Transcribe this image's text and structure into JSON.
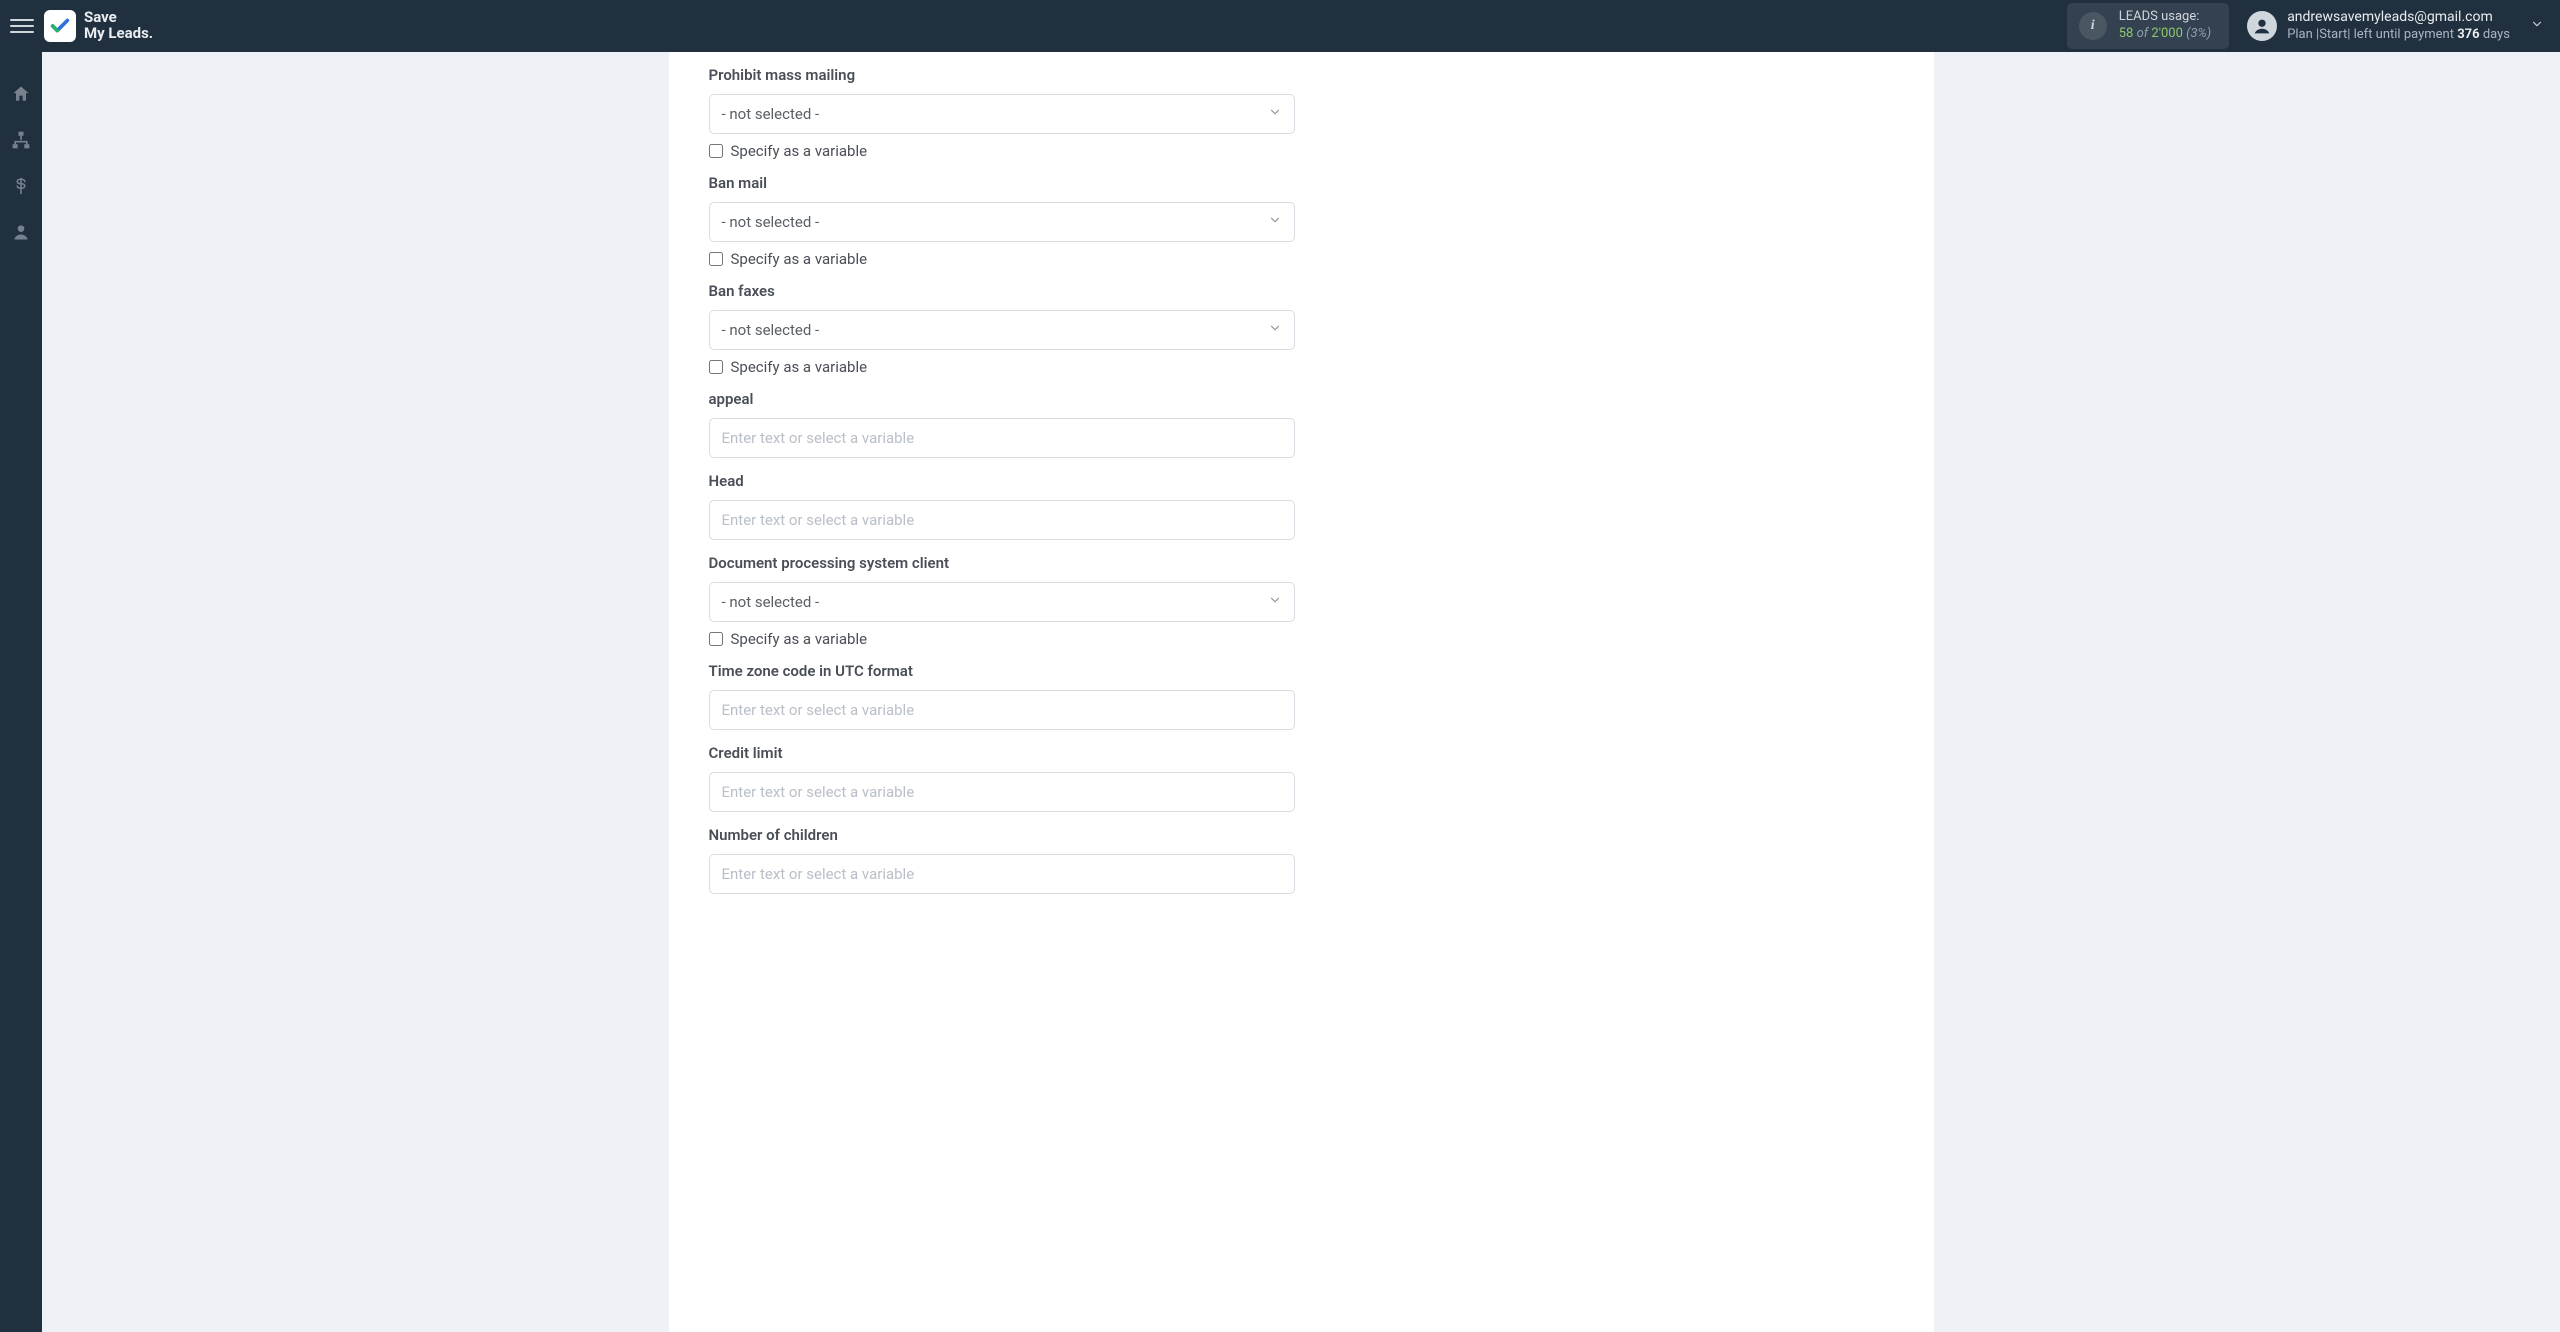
{
  "brand": {
    "line1": "Save",
    "line2": "My Leads."
  },
  "usage": {
    "label": "LEADS usage:",
    "used": "58",
    "of_word": "of",
    "total": "2'000",
    "pct": "(3%)"
  },
  "user": {
    "email": "andrewsavemyleads@gmail.com",
    "plan_prefix": "Plan |Start| left until payment ",
    "plan_days": "376",
    "plan_suffix": " days"
  },
  "strings": {
    "not_selected": "- not selected -",
    "specify_var": "Specify as a variable",
    "placeholder": "Enter text or select a variable"
  },
  "fields": {
    "f0": {
      "label": "Prohibit mass mailing",
      "type": "select",
      "has_var": true
    },
    "f1": {
      "label": "Ban mail",
      "type": "select",
      "has_var": true
    },
    "f2": {
      "label": "Ban faxes",
      "type": "select",
      "has_var": true
    },
    "f3": {
      "label": "appeal",
      "type": "text",
      "has_var": false
    },
    "f4": {
      "label": "Head",
      "type": "text",
      "has_var": false
    },
    "f5": {
      "label": "Document processing system client",
      "type": "select",
      "has_var": true
    },
    "f6": {
      "label": "Time zone code in UTC format",
      "type": "text",
      "has_var": false
    },
    "f7": {
      "label": "Credit limit",
      "type": "text",
      "has_var": false
    },
    "f8": {
      "label": "Number of children",
      "type": "text",
      "has_var": false
    }
  }
}
